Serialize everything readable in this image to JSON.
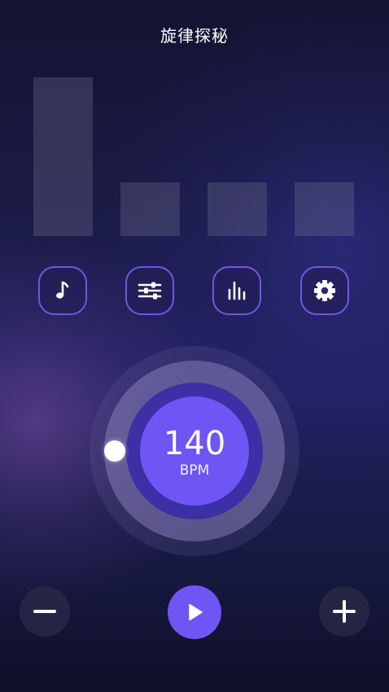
{
  "header": {
    "title": "旋律探秘"
  },
  "levels": {
    "bars": [
      {
        "label": "bar-1",
        "level": 1.0
      },
      {
        "label": "bar-2",
        "level": 0.34
      },
      {
        "label": "bar-3",
        "level": 0.34
      },
      {
        "label": "bar-4",
        "level": 0.34
      }
    ]
  },
  "toolbar": {
    "icons": [
      "music-note-icon",
      "sliders-icon",
      "equalizer-icon",
      "gear-icon"
    ],
    "accent_color": "#6f57e0"
  },
  "tempo": {
    "value": "140",
    "unit": "BPM",
    "slider_position": 0.0
  },
  "controls": {
    "decrease_icon": "minus-icon",
    "play_icon": "play-icon",
    "increase_icon": "plus-icon",
    "play_color": "#6e55f4"
  }
}
